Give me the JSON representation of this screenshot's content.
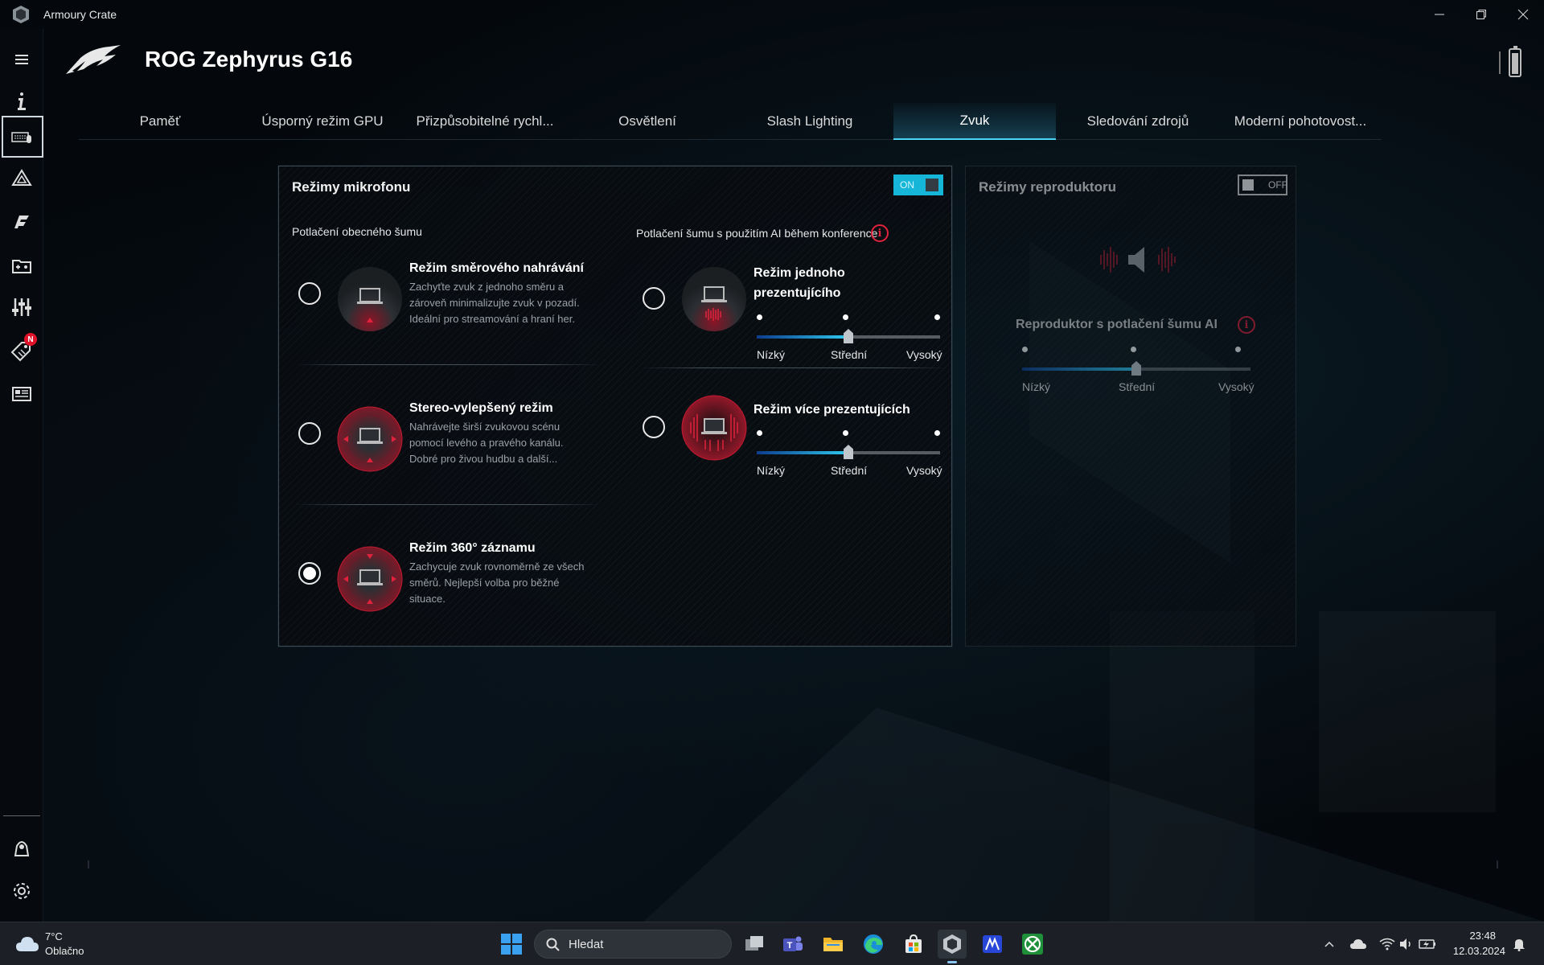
{
  "window": {
    "title": "Armoury Crate"
  },
  "header": {
    "device_name": "ROG Zephyrus G16"
  },
  "tabs": [
    {
      "label": "Paměť"
    },
    {
      "label": "Úsporný režim GPU"
    },
    {
      "label": "Přizpůsobitelné rychl..."
    },
    {
      "label": "Osvětlení"
    },
    {
      "label": "Slash Lighting"
    },
    {
      "label": "Zvuk",
      "active": true
    },
    {
      "label": "Sledování zdrojů"
    },
    {
      "label": "Moderní pohotovost..."
    }
  ],
  "leftnav": {
    "badge": "N"
  },
  "mic": {
    "title": "Režimy mikrofonu",
    "toggle": "ON",
    "general_label": "Potlačení obecného šumu",
    "ai_label": "Potlačení šumu s použitím AI během konference",
    "modes": [
      {
        "title": "Režim směrového nahrávání",
        "desc": [
          "Zachyťte zvuk z jednoho směru a",
          "zároveň minimalizujte zvuk v pozadí.",
          "Ideální pro streamování a hraní her."
        ],
        "selected": false
      },
      {
        "title": "Stereo-vylepšený režim",
        "desc": [
          "Nahrávejte širší zvukovou scénu",
          "pomocí levého a pravého kanálu.",
          "Dobré pro živou hudbu a další..."
        ],
        "selected": false
      },
      {
        "title": "Režim 360° záznamu",
        "desc": [
          "Zachycuje zvuk rovnoměrně ze všech",
          "směrů. Nejlepší volba pro běžné",
          "situace."
        ],
        "selected": true
      }
    ],
    "ai_modes": [
      {
        "title_lines": [
          "Režim jednoho",
          "prezentujícího"
        ],
        "level": 0.5,
        "labels": [
          "Nízký",
          "Střední",
          "Vysoký"
        ],
        "selected": false
      },
      {
        "title_lines": [
          "Režim více prezentujících"
        ],
        "level": 0.5,
        "labels": [
          "Nízký",
          "Střední",
          "Vysoký"
        ],
        "selected": false
      }
    ]
  },
  "speaker": {
    "title": "Režimy reproduktoru",
    "toggle": "OFF",
    "ai_label": "Reproduktor s potlačení šumu AI",
    "level": 0.5,
    "labels": [
      "Nízký",
      "Střední",
      "Vysoký"
    ]
  },
  "taskbar": {
    "weather_temp": "7°C",
    "weather_desc": "Oblačno",
    "search_placeholder": "Hledat",
    "time": "23:48",
    "date": "12.03.2024"
  },
  "colors": {
    "accent": "#16b6d8",
    "red": "#e0223c"
  }
}
